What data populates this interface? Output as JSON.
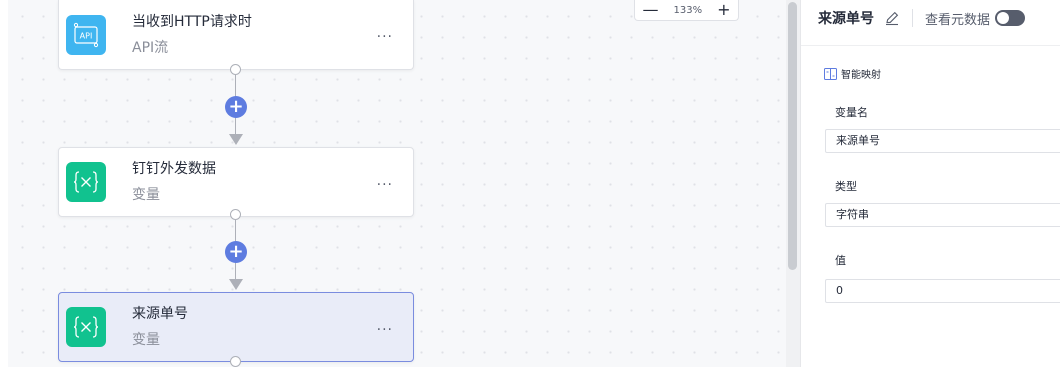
{
  "canvas": {
    "zoom": {
      "minus": "—",
      "value": "133%",
      "plus": "+"
    },
    "nodes": [
      {
        "title": "当收到HTTP请求时",
        "subtitle": "API流",
        "icon": "api-icon",
        "more": "···"
      },
      {
        "title": "钉钉外发数据",
        "subtitle": "变量",
        "icon": "variable-icon",
        "more": "···"
      },
      {
        "title": "来源单号",
        "subtitle": "变量",
        "icon": "variable-icon",
        "more": "···",
        "selected": true
      }
    ],
    "add_symbol": "+"
  },
  "panel": {
    "title": "来源单号",
    "view_metadata_label": "查看元数据",
    "view_metadata_on": false,
    "smart_mapping_label": "智能映射",
    "fields": {
      "name_label": "变量名",
      "name_value": "来源单号",
      "type_label": "类型",
      "type_value": "字符串",
      "value_label": "值",
      "value_value": "0"
    }
  },
  "colors": {
    "api_icon_bg": "#3fb5f0",
    "variable_icon_bg": "#11c28f",
    "add_button": "#5e7ce0",
    "selected_node_bg": "#e9ecf8",
    "selected_node_border": "#7a8cdf"
  }
}
